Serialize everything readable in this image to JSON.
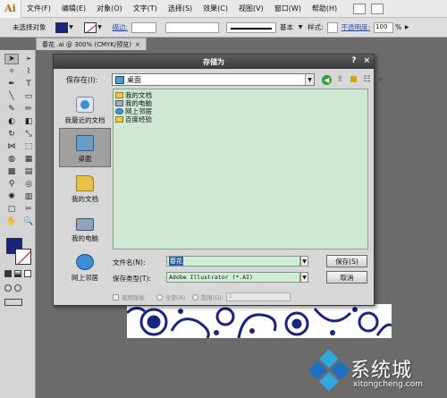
{
  "app": {
    "logo": "Ai"
  },
  "menu": {
    "items": [
      "文件(F)",
      "编辑(E)",
      "对象(O)",
      "文字(T)",
      "选择(S)",
      "效果(C)",
      "视图(V)",
      "窗口(W)",
      "帮助(H)"
    ]
  },
  "controlbar": {
    "selection": "未选择对象",
    "stroke_label": "描边:",
    "stroke_style": "基本",
    "style_label": "样式:",
    "opacity_label": "不透明度:",
    "opacity_value": "100",
    "opacity_unit": "%"
  },
  "document_tab": {
    "title": "春花 .ai @ 300% (CMYK/预览)",
    "close": "×"
  },
  "dialog": {
    "title": "存储为",
    "help_button": "?",
    "close_button": "×",
    "save_in_label": "保存在(I):",
    "save_in_value": "桌面",
    "places": [
      {
        "label": "我最近的文档",
        "icon": "recent-docs-icon"
      },
      {
        "label": "桌面",
        "icon": "desktop-icon"
      },
      {
        "label": "我的文档",
        "icon": "my-documents-icon"
      },
      {
        "label": "我的电脑",
        "icon": "my-computer-icon"
      },
      {
        "label": "网上邻居",
        "icon": "network-places-icon"
      }
    ],
    "files": [
      {
        "name": "我的文档",
        "icon": "folder-icon"
      },
      {
        "name": "我的电脑",
        "icon": "computer-icon"
      },
      {
        "name": "网上邻居",
        "icon": "network-icon"
      },
      {
        "name": "百度经验",
        "icon": "folder-icon"
      }
    ],
    "filename_label": "文件名(N):",
    "filename_value": "春花",
    "filetype_label": "保存类型(T):",
    "filetype_value": "Adobe Illustrator (*.AI)",
    "save_button": "保存(S)",
    "cancel_button": "取消",
    "option_use_artboards": "使用画板",
    "option_all": "全部(A)",
    "option_range": "范围(G):",
    "range_value": "1"
  },
  "watermark": {
    "text": "系统城",
    "url": "xitongcheng.com"
  },
  "colors": {
    "fill": "#1a237e",
    "dialog_title": "#3a3a3a",
    "file_list_bg": "#cfe8d4"
  }
}
